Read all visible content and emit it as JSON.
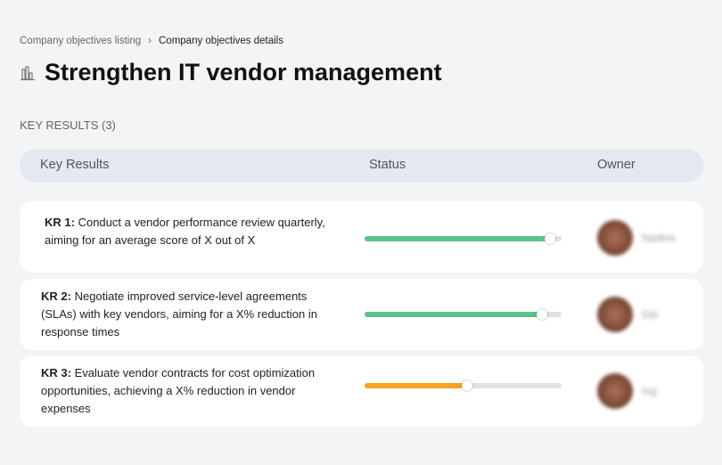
{
  "breadcrumb": {
    "items": [
      "Company objectives listing",
      "Company objectives details"
    ],
    "separator": "›"
  },
  "title": "Strengthen IT vendor management",
  "title_icon": "bar-chart-icon",
  "section_label": "KEY RESULTS (3)",
  "table": {
    "headers": [
      "Key Results",
      "Status",
      "Owner"
    ],
    "rows": [
      {
        "id": "KR 1:",
        "text": "Conduct a vendor performance review quarterly, aiming for an average score of X out of X",
        "progress": 94,
        "color": "#5cc28a",
        "owner": "Nadine"
      },
      {
        "id": "KR 2:",
        "text": "Negotiate improved service-level agreements (SLAs) with key vendors, aiming for a X% reduction in response times",
        "progress": 90,
        "color": "#5cc28a",
        "owner": "Dai"
      },
      {
        "id": "KR 3:",
        "text": "Evaluate vendor contracts for cost optimization opportunities, achieving a X% reduction in vendor expenses",
        "progress": 52,
        "color": "#f5a623",
        "owner": "Ing"
      }
    ]
  }
}
